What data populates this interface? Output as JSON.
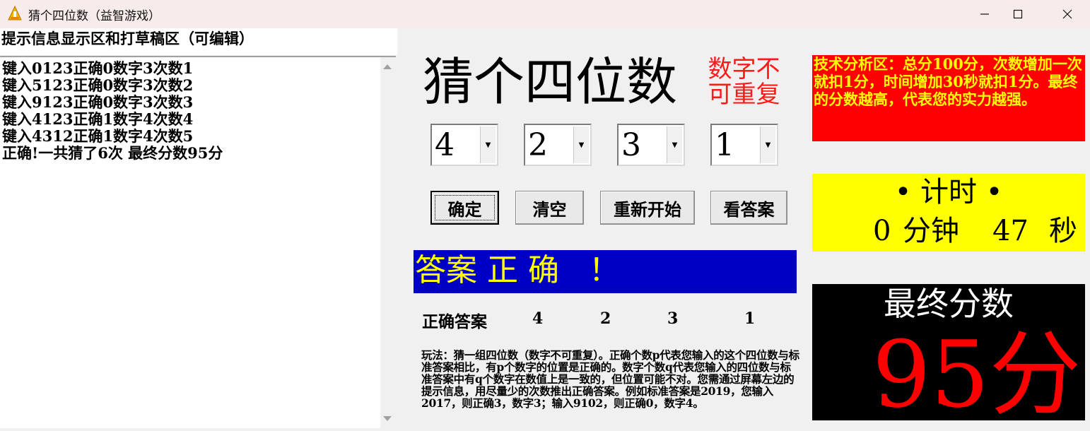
{
  "window": {
    "title": "猜个四位数（益智游戏）",
    "accent_colors": {
      "titlebar_bg": "#f7ece9"
    }
  },
  "notes_panel": {
    "label": "提示信息显示区和打草稿区（可编辑）",
    "lines": [
      "键入0123正确0数字3次数1",
      "键入5123正确0数字3次数2",
      "键入9123正确0数字3次数3",
      "键入4123正确1数字4次数4",
      "键入4312正确1数字4次数5",
      "正确!一共猜了6次  最终分数95分"
    ]
  },
  "game": {
    "title": "猜个四位数",
    "rule_note": "数字不可重复",
    "digits": [
      "4",
      "2",
      "3",
      "1"
    ],
    "buttons": {
      "confirm": "确定",
      "clear": "清空",
      "restart": "重新开始",
      "show_answer": "看答案"
    },
    "result_message": "答案 正 确   ！",
    "answer_label": "正确答案",
    "answer_digits": [
      "4",
      "2",
      "3",
      "1"
    ],
    "instructions": "玩法：猜一组四位数（数字不可重复）。正确个数p代表您输入的这个四位数与标准答案相比，有p个数字的位置是正确的。数字个数q代表您输入的四位数与标准答案中有q个数字在数值上是一致的，但位置可能不对。您需通过屏幕左边的提示信息，用尽量少的次数推出正确答案。例如标准答案是2019，您输入2017，则正确3，数字3；输入9102，则正确0，数字4。"
  },
  "tech_panel": {
    "text": "技术分析区：总分100分，次数增加一次就扣1分，时间增加30秒就扣1分。最终的分数越高，代表您的实力越强。"
  },
  "timer": {
    "label": "• 计时 •",
    "minutes": "0",
    "minutes_unit": "分钟",
    "seconds": "47",
    "seconds_unit": "秒"
  },
  "score": {
    "label": "最终分数",
    "value": "95分"
  },
  "colors": {
    "result_bg": "#0000c4",
    "result_fg": "#ffff00",
    "tech_bg": "#ff0000",
    "tech_fg": "#ffff00",
    "timer_bg": "#ffff00",
    "score_bg": "#000000",
    "score_fg": "#ff0000",
    "rule_note_fg": "#ff1a1a"
  }
}
